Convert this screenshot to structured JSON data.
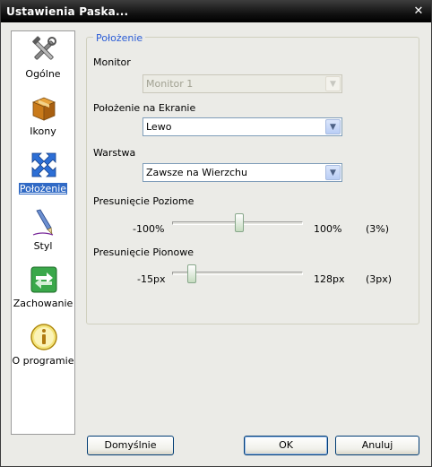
{
  "window": {
    "title": "Ustawienia Paska..."
  },
  "sidebar": {
    "items": [
      {
        "label": "Ogólne",
        "icon": "tools-icon"
      },
      {
        "label": "Ikony",
        "icon": "box-icon"
      },
      {
        "label": "Położenie",
        "icon": "move-arrows-icon",
        "active": true
      },
      {
        "label": "Styl",
        "icon": "pen-icon"
      },
      {
        "label": "Zachowanie",
        "icon": "swap-arrows-icon"
      },
      {
        "label": "O programie",
        "icon": "info-icon"
      }
    ]
  },
  "group": {
    "title": "Położenie"
  },
  "monitor": {
    "label": "Monitor",
    "value": "Monitor 1",
    "disabled": true
  },
  "position": {
    "label": "Położenie na Ekranie",
    "value": "Lewo"
  },
  "layer": {
    "label": "Warstwa",
    "value": "Zawsze na Wierzchu"
  },
  "h_offset": {
    "label": "Presunięcie Poziome",
    "min": "-100%",
    "max": "100%",
    "current": "(3%)",
    "fraction": 0.515
  },
  "v_offset": {
    "label": "Presunięcie Pionowe",
    "min": "-15px",
    "max": "128px",
    "current": "(3px)",
    "fraction": 0.126
  },
  "buttons": {
    "defaults": "Domyślnie",
    "ok": "OK",
    "cancel": "Anuluj"
  },
  "colors": {
    "accent": "#2a5cd6",
    "selection": "#316ac5",
    "titlebar": "#000000"
  }
}
